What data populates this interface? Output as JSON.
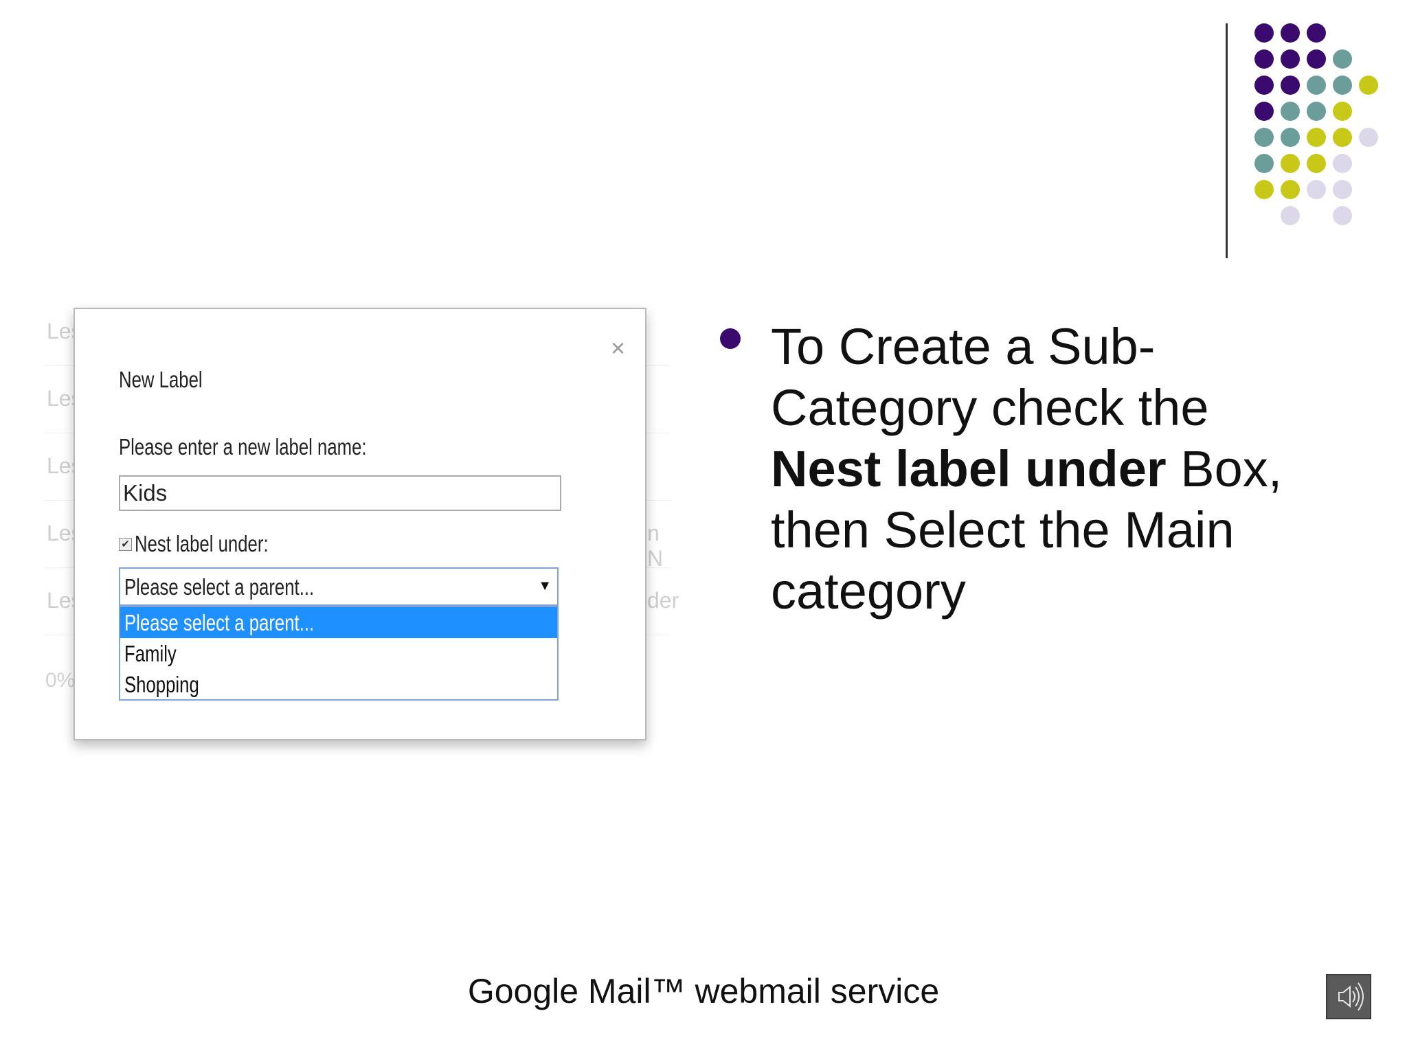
{
  "dialog": {
    "title": "New Label",
    "close_symbol": "×",
    "prompt": "Please enter a new label name:",
    "name_value": "Kids",
    "nest_label": "Nest label under:",
    "nest_checked": true,
    "select_value": "Please select a parent...",
    "options": [
      "Please select a parent...",
      "Family",
      "Shopping"
    ],
    "selected_option": "Please select a parent..."
  },
  "background_rows": [
    {
      "left": "Les",
      "right": ""
    },
    {
      "left": "Les",
      "right": ""
    },
    {
      "left": "Les",
      "right": ""
    },
    {
      "left": "Les",
      "right": "n N"
    },
    {
      "left": "Les",
      "right": "der"
    }
  ],
  "background_percent": "0%)",
  "slide": {
    "text_line1": "To Create a Sub-",
    "text_line2": "Category check the",
    "text_bold": "Nest label under",
    "text_after_bold": " Box,",
    "text_line4": "then Select the Main",
    "text_line5": "category",
    "footer": "Google Mail™ webmail service",
    "speaker_icon": "speaker-icon"
  },
  "colors": {
    "purple": "#3a0a6e",
    "teal": "#6b9e9b",
    "olive": "#c8c818",
    "lavender": "#dcd8ea",
    "selection": "#1e90ff"
  }
}
